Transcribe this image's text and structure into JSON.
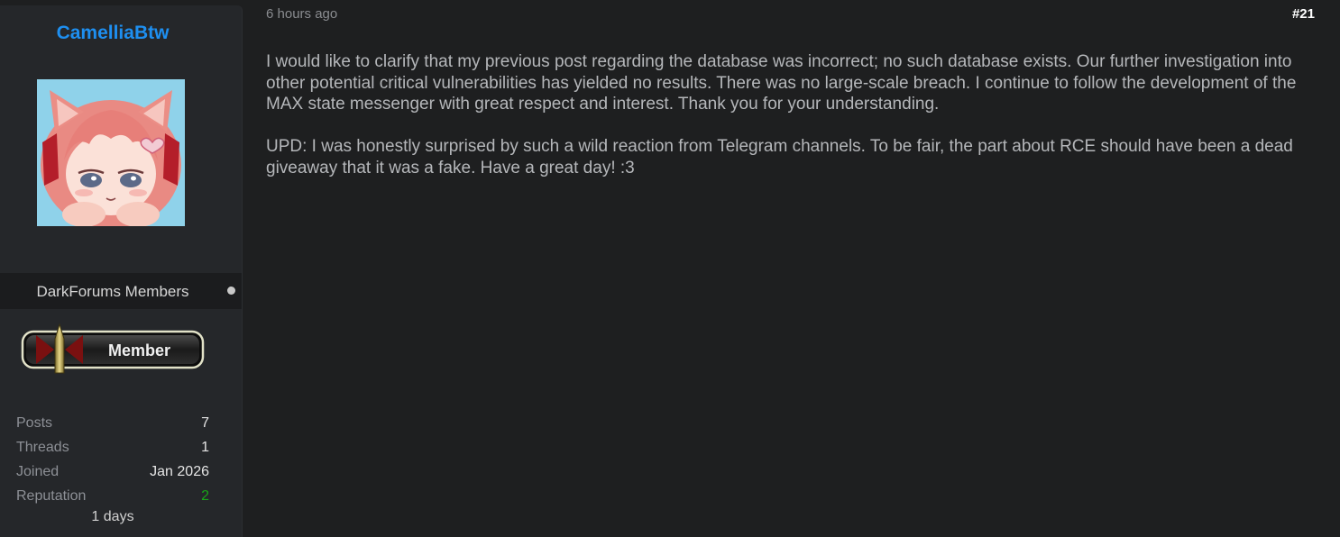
{
  "author": {
    "username": "CamelliaBtw",
    "group": "DarkForums Members",
    "rank_badge_text": "Member",
    "stats": [
      {
        "label": "Posts",
        "value": "7"
      },
      {
        "label": "Threads",
        "value": "1"
      },
      {
        "label": "Joined",
        "value": "Jan 2026"
      },
      {
        "label": "Reputation",
        "value": "2"
      }
    ],
    "days": "1 days",
    "colors": {
      "username": "#1e8ff0",
      "reputation_positive": "#18a418"
    }
  },
  "post": {
    "timestamp": "6 hours ago",
    "number": "#21",
    "paragraphs": [
      "I would like to clarify that my previous post regarding the database was incorrect; no such database exists. Our further investigation into other potential critical vulnerabilities has yielded no results. There was no large-scale breach. I continue to follow the development of the MAX state messenger with great respect and interest. Thank you for your understanding.",
      "UPD: I was honestly surprised by such a wild reaction from Telegram channels. To be fair, the part about RCE should have been a dead giveaway that it was a fake. Have a great day! :3"
    ]
  }
}
